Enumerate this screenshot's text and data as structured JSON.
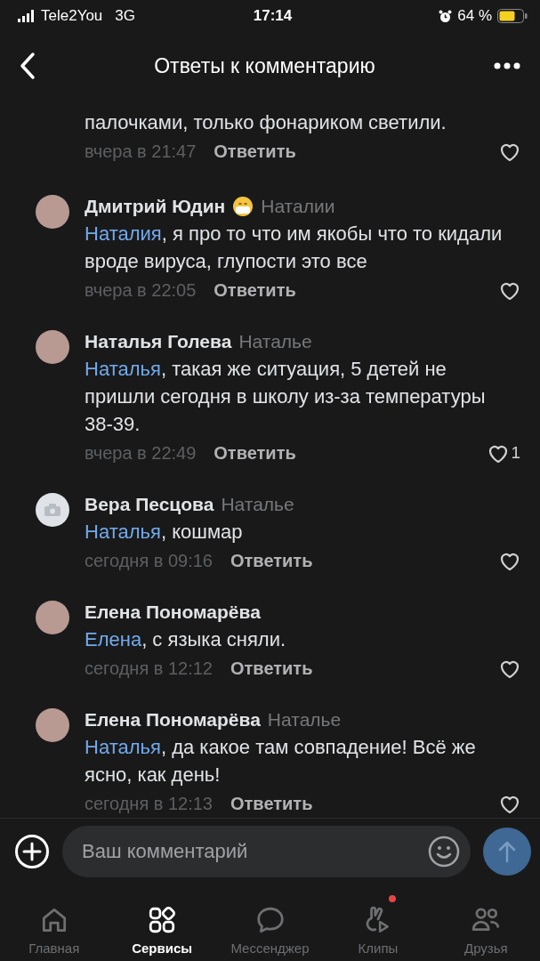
{
  "status_bar": {
    "carrier": "Tele2You",
    "network": "3G",
    "time": "17:14",
    "battery": "64 %"
  },
  "header": {
    "title": "Ответы к комментарию"
  },
  "comments": [
    {
      "kind": "partial",
      "text": "палочками, только фонариком светили.",
      "time": "вчера в 21:47",
      "reply": "Ответить"
    },
    {
      "kind": "photo",
      "author": "Дмитрий Юдин",
      "emoji": true,
      "reply_to": "Наталии",
      "mention": "Наталия",
      "text": ", я про то что им якобы что то кидали вроде вируса, глупости это все",
      "time": "вчера в 22:05",
      "reply": "Ответить"
    },
    {
      "kind": "photo",
      "author": "Наталья Голева",
      "reply_to": "Наталье",
      "mention": "Наталья",
      "text": ", такая же ситуация, 5 детей не пришли сегодня в школу из-за температуры 38-39.",
      "time": "вчера в 22:49",
      "reply": "Ответить",
      "likes": "1"
    },
    {
      "kind": "camera",
      "author": "Вера Песцова",
      "reply_to": "Наталье",
      "mention": "Наталья",
      "text": ", кошмар",
      "time": "сегодня в 09:16",
      "reply": "Ответить"
    },
    {
      "kind": "photo",
      "author": "Елена Пономарёва",
      "mention": "Елена",
      "text": ", с языка сняли.",
      "time": "сегодня в 12:12",
      "reply": "Ответить"
    },
    {
      "kind": "photo",
      "author": "Елена Пономарёва",
      "reply_to": "Наталье",
      "mention": "Наталья",
      "text": ", да какое там совпадение!  Всё же ясно, как день!",
      "time": "сегодня в 12:13",
      "reply": "Ответить"
    }
  ],
  "composer": {
    "placeholder": "Ваш комментарий"
  },
  "tabs": [
    {
      "kind": "home",
      "label": "Главная",
      "selected": false
    },
    {
      "kind": "services",
      "label": "Сервисы",
      "selected": true
    },
    {
      "kind": "messenger",
      "label": "Мессенджер",
      "selected": false
    },
    {
      "kind": "clips",
      "label": "Клипы",
      "selected": false,
      "badge": true
    },
    {
      "kind": "friends",
      "label": "Друзья",
      "selected": false
    }
  ]
}
